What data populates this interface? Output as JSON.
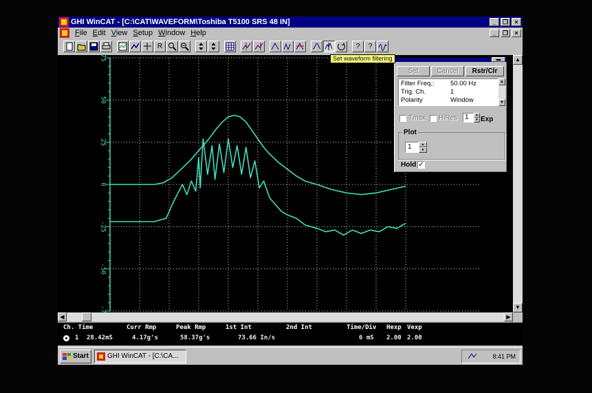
{
  "window": {
    "title": "GHI WinCAT - [C:\\CAT\\WAVEFORM\\Toshiba T5100 SRS 48 IN]",
    "buttons": {
      "minimize": "_",
      "restore": "❐",
      "close": "×"
    }
  },
  "menu": {
    "items": [
      "File",
      "Edit",
      "View",
      "Setup",
      "Window",
      "Help"
    ]
  },
  "toolbar": {
    "tooltip": "Set waveform filtering",
    "buttons": [
      "new-icon",
      "open-icon",
      "save-icon",
      "print-icon",
      "view1-icon",
      "view2-icon",
      "view3-icon",
      "r-icon",
      "zoom-in-icon",
      "zoom-out-icon",
      "up-down-icon",
      "up-down-icon-2",
      "grid-icon",
      "cursor1-icon",
      "cursor2-icon",
      "wave1-icon",
      "wave2-icon",
      "wave3-icon",
      "wave4-icon",
      "filter-icon",
      "refresh-icon",
      "help-icon",
      "context-help-icon",
      "about-icon"
    ],
    "labels": {
      "r": "R",
      "help": "?",
      "context_help": "?"
    }
  },
  "chart_data": {
    "type": "line",
    "title": "",
    "xlabel": "",
    "ylabel": "",
    "yticks": [
      "75",
      "50",
      "25",
      "0",
      "-25",
      "-50",
      "-75"
    ],
    "ylim": [
      -75,
      75
    ],
    "xlim": [
      0,
      10
    ],
    "x_divisions": 10,
    "grid": true,
    "line_color": "#40e0c0",
    "series": [
      {
        "x": [
          0,
          0.3,
          0.6,
          0.9,
          1.2,
          1.5,
          1.8,
          2.1,
          2.4,
          2.7,
          3.0,
          3.3,
          3.6,
          3.8,
          4.0,
          4.2,
          4.4,
          4.6,
          4.8,
          5.0,
          5.2,
          5.4,
          5.7,
          6.0,
          6.3,
          6.6,
          7.0,
          7.5,
          8.0,
          8.5,
          9.0,
          9.5,
          10.0
        ],
        "y": [
          0,
          0,
          0,
          0,
          0,
          0,
          1,
          4,
          9,
          14,
          20,
          26,
          33,
          37,
          40,
          41,
          40,
          37,
          32,
          27,
          22,
          18,
          13,
          9,
          5,
          2,
          0,
          -3,
          -5,
          -6,
          -5,
          -3,
          -1
        ]
      },
      {
        "x": [
          0,
          0.5,
          1.0,
          1.5,
          1.9,
          2.1,
          2.3,
          2.45,
          2.6,
          2.75,
          2.9,
          3.0,
          3.05,
          3.15,
          3.3,
          3.45,
          3.55,
          3.7,
          3.85,
          4.0,
          4.15,
          4.3,
          4.45,
          4.6,
          4.75,
          4.9,
          5.05,
          5.2,
          5.4,
          5.6,
          5.8,
          6.0,
          6.3,
          6.6,
          7.0,
          7.3,
          7.6,
          7.9,
          8.2,
          8.5,
          8.8,
          9.1,
          9.4,
          9.7,
          10.0
        ],
        "y": [
          -22,
          -22,
          -22,
          -22,
          -20,
          -12,
          -5,
          0,
          -6,
          2,
          -4,
          16,
          -2,
          27,
          6,
          23,
          3,
          24,
          7,
          27,
          10,
          23,
          6,
          22,
          4,
          14,
          -2,
          2,
          -8,
          -12,
          -16,
          -18,
          -20,
          -24,
          -26,
          -28,
          -27,
          -30,
          -27,
          -29,
          -27,
          -28,
          -25,
          -26,
          -23
        ]
      }
    ]
  },
  "filter_panel": {
    "set_label": "Set",
    "cancel_label": "Cancel",
    "rstr_label": "Rstr/Clr",
    "params": [
      {
        "name": "Filter Freq.:",
        "value": "50.00 Hz"
      },
      {
        "name": "Trig. Ch.",
        "value": "1"
      },
      {
        "name": "Polarity",
        "value": "Window"
      }
    ],
    "tmax_label": "Tmax",
    "hires_label": "HiRes",
    "exp_value": "1",
    "exp_label": "Exp",
    "plot_label": "Plot",
    "plot_value": "1",
    "hold_label": "Hold",
    "hold_checked": "✓"
  },
  "cursor_panel": {
    "headers": {
      "ch_time": "Ch. Time",
      "curr_rmp": "Curr Rmp",
      "peak_rmp": "Peak Rmp",
      "first_int": "1st Int",
      "second_int": "2nd Int",
      "time_div": "Time/Div",
      "hexp": "Hexp",
      "vexp": "Vexp"
    },
    "row": {
      "ch": "1",
      "time": "28.42mS",
      "curr_rmp": "4.17g's",
      "peak_rmp": "58.37g's",
      "first_int": "73.66 In/s",
      "time_div": "6 mS",
      "hexp": "2.00",
      "vexp": "2.00"
    }
  },
  "taskbar": {
    "start_label": "Start",
    "task_label": "GHI WinCAT - [C:\\CA...",
    "clock": "8:41 PM"
  },
  "colors": {
    "titlebar": "#000080",
    "plot_bg": "#000000",
    "trace": "#40e0c0",
    "grid": "#d8d8d8",
    "axis": "#40e0c0",
    "tooltip_bg": "#ffff80"
  }
}
